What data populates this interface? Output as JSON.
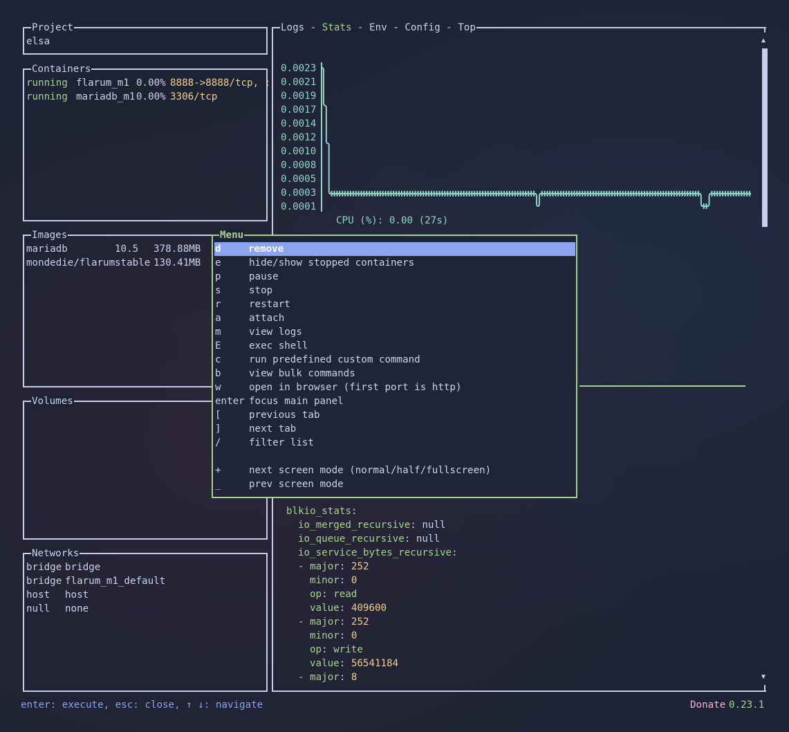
{
  "panels": {
    "project": {
      "title": "Project",
      "value": "elsa"
    },
    "containers": {
      "title": "Containers",
      "rows": [
        {
          "status": "running",
          "name": "flarum_m1",
          "cpu": "0.00%",
          "ports": "8888->8888/tcp, :"
        },
        {
          "status": "running",
          "name": "mariadb_m1",
          "cpu": "0.00%",
          "ports": "3306/tcp"
        }
      ]
    },
    "images": {
      "title": "Images",
      "rows": [
        {
          "name": "mariadb",
          "tag": "10.5",
          "size": "378.88MB"
        },
        {
          "name": "mondedie/flarum",
          "tag": "stable",
          "size": "130.41MB"
        }
      ]
    },
    "volumes": {
      "title": "Volumes"
    },
    "networks": {
      "title": "Networks",
      "rows": [
        {
          "driver": "bridge",
          "name": "bridge"
        },
        {
          "driver": "bridge",
          "name": "flarum_m1_default"
        },
        {
          "driver": "host",
          "name": "host"
        },
        {
          "driver": "null",
          "name": "none"
        }
      ]
    }
  },
  "main": {
    "tabs": [
      "Logs",
      "Stats",
      "Env",
      "Config",
      "Top"
    ],
    "active_tab": "Stats",
    "tab_separator": " - "
  },
  "chart_data": {
    "type": "line",
    "title": "CPU (%): 0.00 (27s)",
    "y_ticks": [
      "0.0023",
      "0.0021",
      "0.0019",
      "0.0017",
      "0.0014",
      "0.0012",
      "0.0010",
      "0.0008",
      "0.0005",
      "0.0003",
      "0.0001"
    ],
    "ylim": [
      0.0001,
      0.0023
    ],
    "color": "#8fd6c8",
    "series": [
      {
        "values": [
          0.0023,
          0.0017,
          0.0011,
          0.0003,
          0.0003,
          0.0003,
          0.0003,
          0.0003,
          0.0003,
          0.0003,
          0.0003,
          0.0003,
          0.0003,
          0.0003,
          0.0003,
          0.0003,
          0.0003,
          0.0003,
          0.0003,
          0.0003,
          0.0003,
          0.0003,
          0.0003,
          0.0003,
          0.0003,
          0.0003,
          0.0003,
          0.0003,
          0.0003,
          0.0003,
          0.0003,
          0.0003,
          0.0003,
          0.0003,
          0.0003,
          0.0003,
          0.0003,
          0.0003,
          0.0003,
          0.0003,
          0.0003,
          0.0003,
          0.0003,
          0.0003,
          0.0003,
          0.0003,
          0.0003,
          0.0003,
          0.0003,
          0.0003,
          0.0003,
          0.0003,
          0.0003,
          0.0003,
          0.0003,
          0.0003,
          0.0003,
          0.0003,
          0.0003,
          0.0003,
          0.0003,
          0.0003,
          0.0003,
          0.0003,
          0.0003,
          0.0003,
          0.0003,
          0.0003,
          0.0003,
          0.0003,
          0.0003,
          0.0003,
          0.0003,
          0.0003,
          0.0003,
          0.0003,
          0.0003,
          0.0003,
          0.0003,
          0.0003,
          0.0001,
          0.0003,
          0.0003,
          0.0003,
          0.0003,
          0.0003,
          0.0003,
          0.0003,
          0.0003,
          0.0003,
          0.0003,
          0.0003,
          0.0003,
          0.0003,
          0.0003,
          0.0003,
          0.0003,
          0.0003,
          0.0003,
          0.0003,
          0.0003,
          0.0003,
          0.0003,
          0.0003,
          0.0003,
          0.0003,
          0.0003,
          0.0003,
          0.0003,
          0.0003,
          0.0003,
          0.0003,
          0.0003,
          0.0003,
          0.0003,
          0.0003,
          0.0003,
          0.0003,
          0.0003,
          0.0003,
          0.0003,
          0.0003,
          0.0003,
          0.0003,
          0.0003,
          0.0003,
          0.0003,
          0.0003,
          0.0003,
          0.0003,
          0.0003,
          0.0003,
          0.0003,
          0.0003,
          0.0003,
          0.0003,
          0.0003,
          0.0003,
          0.0003,
          0.0003,
          0.0003,
          0.0001,
          0.0001,
          0.0001,
          0.0003,
          0.0003,
          0.0003,
          0.0003,
          0.0003,
          0.0003,
          0.0003,
          0.0003,
          0.0003,
          0.0003,
          0.0003,
          0.0003,
          0.0003,
          0.0003,
          0.0003,
          0.0003
        ]
      }
    ]
  },
  "yaml": [
    {
      "indent": 0,
      "key": "blkio_stats",
      "sep": ":",
      "value": "",
      "vclass": ""
    },
    {
      "indent": 1,
      "key": "io_merged_recursive",
      "sep": ": ",
      "value": "null",
      "vclass": "dim"
    },
    {
      "indent": 1,
      "key": "io_queue_recursive",
      "sep": ": ",
      "value": "null",
      "vclass": "dim"
    },
    {
      "indent": 1,
      "key": "io_service_bytes_recursive",
      "sep": ":",
      "value": "",
      "vclass": ""
    },
    {
      "indent": 1,
      "dash": true,
      "key": "major",
      "sep": ": ",
      "value": "252",
      "vclass": "yellow"
    },
    {
      "indent": 2,
      "key": "minor",
      "sep": ": ",
      "value": "0",
      "vclass": "yellow"
    },
    {
      "indent": 2,
      "key": "op",
      "sep": ": ",
      "value": "read",
      "vclass": "green"
    },
    {
      "indent": 2,
      "key": "value",
      "sep": ": ",
      "value": "409600",
      "vclass": "yellow"
    },
    {
      "indent": 1,
      "dash": true,
      "key": "major",
      "sep": ": ",
      "value": "252",
      "vclass": "yellow"
    },
    {
      "indent": 2,
      "key": "minor",
      "sep": ": ",
      "value": "0",
      "vclass": "yellow"
    },
    {
      "indent": 2,
      "key": "op",
      "sep": ": ",
      "value": "write",
      "vclass": "green"
    },
    {
      "indent": 2,
      "key": "value",
      "sep": ": ",
      "value": "56541184",
      "vclass": "yellow"
    },
    {
      "indent": 1,
      "dash": true,
      "key": "major",
      "sep": ": ",
      "value": "8",
      "vclass": "yellow"
    }
  ],
  "menu": {
    "title": "Menu",
    "selected_index": 0,
    "items": [
      {
        "key": "d",
        "label": "remove"
      },
      {
        "key": "e",
        "label": "hide/show stopped containers"
      },
      {
        "key": "p",
        "label": "pause"
      },
      {
        "key": "s",
        "label": "stop"
      },
      {
        "key": "r",
        "label": "restart"
      },
      {
        "key": "a",
        "label": "attach"
      },
      {
        "key": "m",
        "label": "view logs"
      },
      {
        "key": "E",
        "label": "exec shell"
      },
      {
        "key": "c",
        "label": "run predefined custom command"
      },
      {
        "key": "b",
        "label": "view bulk commands"
      },
      {
        "key": "w",
        "label": "open in browser (first port is http)"
      },
      {
        "key": "enter",
        "label": "focus main panel"
      },
      {
        "key": "[",
        "label": "previous tab"
      },
      {
        "key": "]",
        "label": "next tab"
      },
      {
        "key": "/",
        "label": "filter list"
      },
      {
        "key": "",
        "label": ""
      },
      {
        "key": "+",
        "label": "next screen mode (normal/half/fullscreen)"
      },
      {
        "key": "_",
        "label": "prev screen mode"
      }
    ]
  },
  "footer": {
    "help": "enter: execute, esc: close, ↑ ↓: navigate",
    "donate": "Donate",
    "version": "0.23.1"
  },
  "scrollbar": {
    "up": "▲",
    "down": "▼"
  },
  "colors": {
    "border": "#c8cdeb",
    "active_border": "#a7d38f",
    "selection": "#8aa4ef",
    "running": "#a7d38f",
    "port": "#f0cf8f",
    "chart": "#8fd6c8"
  }
}
